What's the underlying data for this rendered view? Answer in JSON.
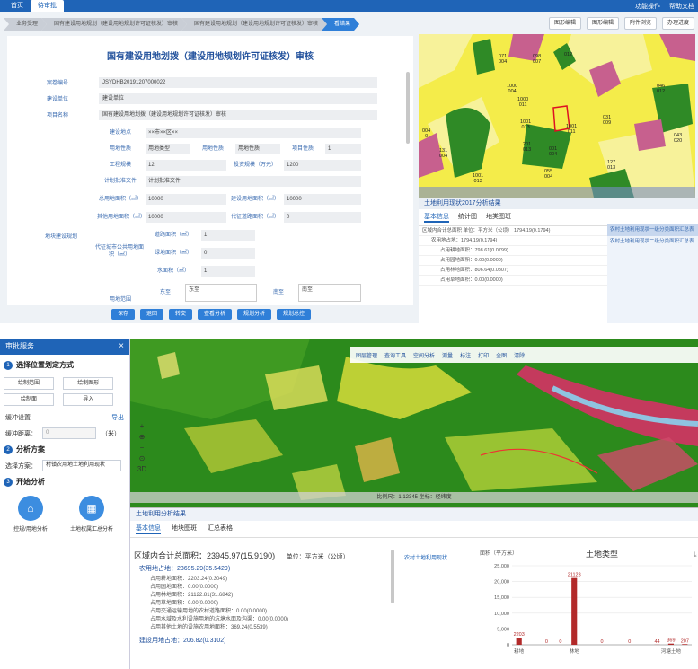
{
  "top": {
    "tabs": [
      "首页",
      "待审批"
    ],
    "right_links": [
      "功能操作",
      "帮助文档"
    ],
    "flow": [
      "业务受理",
      "国有建设用地规划（建设用地规划许可证核发）审核",
      "",
      "国有建设用地规划（建设用地规划许可证核发）审核",
      "看结果"
    ],
    "toolbuttons": [
      "图形编辑",
      "图形编辑",
      "附件浏览",
      "办理进度"
    ],
    "form_title": "国有建设用地划拨（建设用地规划许可证核发）审核",
    "rows": [
      {
        "label": "案卷编号",
        "value": "JSYDHB20191207000022"
      },
      {
        "label": "建设单位",
        "value": "建设单位"
      },
      {
        "label": "项目名称",
        "value": "国有建设用地划拨（建设用地规划许可证核发）审核"
      }
    ],
    "section_label": "地块建设规划",
    "sub": [
      {
        "l": "建设地点",
        "v": "××市××区××"
      },
      {
        "l": "用地性质",
        "v": "用地类型"
      },
      {
        "l": "用地性质",
        "v": "用地性质"
      },
      {
        "l": "项目性质",
        "v": "1"
      },
      {
        "l": "工程规模",
        "v": "12"
      },
      {
        "l": "投资规模（万元）",
        "v": "1200"
      },
      {
        "l": "计划批准文件",
        "v": "计划批准文件"
      },
      {
        "l": "总用地面积（㎡）",
        "v": "10000"
      },
      {
        "l": "建设用地面积（㎡）",
        "v": "10000"
      },
      {
        "l": "其他用地面积（㎡）",
        "v": "10000"
      },
      {
        "l": "代征道路面积（㎡）",
        "v": "0"
      },
      {
        "l": "代征城市公共用地面积（㎡）",
        "v": ""
      },
      {
        "l": "道路面积（㎡）",
        "v": "1"
      },
      {
        "l": "绿地面积（㎡）",
        "v": "0"
      },
      {
        "l": "水面积（㎡）",
        "v": "1"
      },
      {
        "l": "用地范围",
        "v": ""
      },
      {
        "l": "东至",
        "v": "东至"
      },
      {
        "l": "南至",
        "v": "南至"
      }
    ],
    "buttons": [
      "保存",
      "退回",
      "转交",
      "查看分析",
      "规划分析",
      "规划总控"
    ],
    "analysis": {
      "title": "土地利用现状2017分析结果",
      "tabs": [
        "基本信息",
        "统计图",
        "地类图斑"
      ],
      "lines": [
        "区域内合计总面积 单位：平方米（公顷） 1794.19(0.1794)",
        "农用地占地：1794.19(0.1794)",
        "占用耕地面积：798.61(0.0799)",
        "占用园地面积：0.00(0.0000)",
        "占用林地面积：806.64(0.0807)",
        "占用草地面积：0.00(0.0000)"
      ],
      "side": [
        "农村土地利用现状一级分类面积汇总表",
        "农村土地利用现状二级分类面积汇总表"
      ]
    },
    "map_labels": [
      {
        "t": "071\n004",
        "x": 89,
        "y": 22
      },
      {
        "t": "098\n007",
        "x": 127,
        "y": 22
      },
      {
        "t": "012",
        "x": 162,
        "y": 20
      },
      {
        "t": "1000\n004",
        "x": 98,
        "y": 55
      },
      {
        "t": "1000\n011",
        "x": 110,
        "y": 70
      },
      {
        "t": "1001\n013",
        "x": 113,
        "y": 95
      },
      {
        "t": "1001\n011",
        "x": 164,
        "y": 100
      },
      {
        "t": "046\n012",
        "x": 265,
        "y": 55
      },
      {
        "t": "004\n0",
        "x": 4,
        "y": 105
      },
      {
        "t": "131\n004",
        "x": 23,
        "y": 127
      },
      {
        "t": "1001\n013",
        "x": 60,
        "y": 155
      },
      {
        "t": "201\n013",
        "x": 116,
        "y": 120
      },
      {
        "t": "001\n004",
        "x": 145,
        "y": 125
      },
      {
        "t": "127\n013",
        "x": 210,
        "y": 140
      },
      {
        "t": "031\n009",
        "x": 205,
        "y": 90
      },
      {
        "t": "055\n004",
        "x": 140,
        "y": 150
      },
      {
        "t": "043\n020",
        "x": 284,
        "y": 110
      }
    ]
  },
  "bottom": {
    "panel_title": "审批服务",
    "sec1": "选择位置划定方式",
    "draw_buttons": [
      "绘制范围",
      "绘制图形",
      "绘制面",
      "导入"
    ],
    "tolerance_label": "缓冲设置",
    "export_label": "导出",
    "buffer_label": "缓冲距离：",
    "buffer_value": "0",
    "buffer_unit": "（米）",
    "sec2": "分析方案",
    "scheme_label": "选择方案：",
    "scheme_value": "村镇农用地土地利用现状",
    "sec3": "开始分析",
    "big_buttons": [
      "控规/用地分析",
      "土地权属汇总分析"
    ],
    "map_tools": [
      "图层管理",
      "查询工具",
      "空间分析",
      "测量",
      "标注",
      "打印",
      "全图",
      "清除"
    ],
    "status": "比例尺：1:12345  坐标：经纬度",
    "zoom": [
      "+",
      "⊕",
      "−",
      "⊙",
      "3D"
    ],
    "analysis_title": "土地利用分析结果",
    "tabs": [
      "基本信息",
      "地块图斑",
      "汇总表格"
    ],
    "total_label": "区域内合计总面积：",
    "total_value": "23945.97(15.9190)",
    "unit_label": "单位：平方米（公顷）",
    "ag_label": "农用地占地：23695.29(35.5429)",
    "ag_lines": [
      "占用耕地面积：2203.24(0.3049)",
      "占用园地面积：0.00(0.0000)",
      "占用林地面积：21122.81(31.6842)",
      "占用草地面积：0.00(0.0000)",
      "占用交通运输用地的农村道路面积：0.00(0.0000)",
      "占用水域及水利设施用地的坑塘水面及沟渠：0.00(0.0000)",
      "占用其他土地的设施农用地面积：369.24(0.5539)"
    ],
    "build_label": "建设用地占地：206.82(0.3102)",
    "legend_item": "农村土地利用现状",
    "chart_ylabel": "面积（平方米）"
  },
  "chart_data": {
    "type": "bar",
    "title": "土地类型",
    "ylabel": "面积（平方米）",
    "yticks": [
      "0",
      "5,000",
      "10,000",
      "15,000",
      "20,000",
      "25,000"
    ],
    "ylim": [
      0,
      25000
    ],
    "categories": [
      "耕地",
      "",
      "",
      "",
      "林地",
      "",
      "",
      "",
      "",
      "",
      "",
      "河塘土地",
      ""
    ],
    "xtick_labels": [
      "耕地",
      "林地",
      "河塘土地"
    ],
    "values": [
      2203,
      0,
      0,
      0,
      21123,
      0,
      0,
      0,
      0,
      0,
      44,
      369,
      207
    ],
    "data_labels": [
      "2203",
      "",
      "0",
      "0",
      "21123",
      "",
      "0",
      "",
      "0",
      "",
      "44",
      "369",
      "207"
    ],
    "color": "#b22a2a"
  }
}
